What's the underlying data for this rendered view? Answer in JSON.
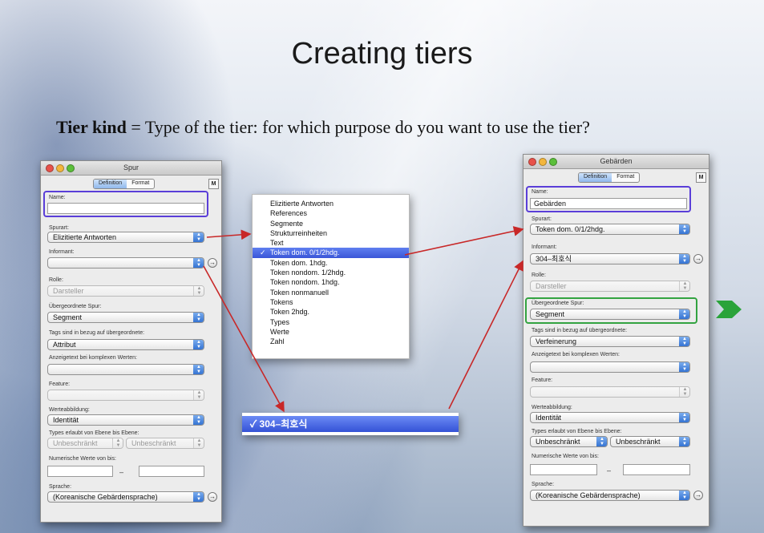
{
  "slide": {
    "title": "Creating tiers",
    "subtitle_bold": "Tier kind",
    "subtitle_rest": " = Type of the tier: for which purpose do you want to use the tier?"
  },
  "left_window": {
    "title": "Spur",
    "tab_definition": "Definition",
    "tab_format": "Format",
    "m_button": "M",
    "name_label": "Name:",
    "name_value": "",
    "spurart_label": "Spurart:",
    "spurart_value": "Elizitierte Antworten",
    "informant_label": "Informant:",
    "informant_value": "",
    "rolle_label": "Rolle:",
    "rolle_value": "Darsteller",
    "parent_label": "Übergeordnete Spur:",
    "parent_value": "Segment",
    "tags_label": "Tags sind in bezug auf übergeordnete:",
    "tags_value": "Attribut",
    "display_label": "Anzeigetext bei komplexen Werten:",
    "display_value": "",
    "feature_label": "Feature:",
    "feature_value": "",
    "mapping_label": "Werteabbildung:",
    "mapping_value": "Identität",
    "types_label": "Types erlaubt von Ebene bis Ebene:",
    "types_from": "Unbeschränkt",
    "types_to": "Unbeschränkt",
    "numeric_label": "Numerische Werte von bis:",
    "numeric_dash": "–",
    "language_label": "Sprache:",
    "language_value": "(Koreanische Gebärdensprache)"
  },
  "tier_menu": {
    "items": [
      "Elizitierte Antworten",
      "References",
      "Segmente",
      "Strukturreinheiten",
      "Text",
      "Token dom. 0/1/2hdg.",
      "Token dom. 1hdg.",
      "Token nondom. 1/2hdg.",
      "Token nondom. 1hdg.",
      "Token nonmanuell",
      "Tokens",
      "Token 2hdg.",
      "Types",
      "Werte",
      "Zahl"
    ],
    "selected": "Token dom. 0/1/2hdg.",
    "check": "✓"
  },
  "informant_menu": {
    "check": "✓",
    "selected": "304–최호식"
  },
  "right_window": {
    "title": "Gebärden",
    "tab_definition": "Definition",
    "tab_format": "Format",
    "m_button": "M",
    "name_label": "Name:",
    "name_value": "Gebärden",
    "spurart_label": "Spurart:",
    "spurart_value": "Token dom. 0/1/2hdg.",
    "informant_label": "Informant:",
    "informant_value": "304–최호식",
    "rolle_label": "Rolle:",
    "rolle_value": "Darsteller",
    "parent_label": "Übergeordnete Spur:",
    "parent_value": "Segment",
    "tags_label": "Tags sind in bezug auf übergeordnete:",
    "tags_value": "Verfeinerung",
    "display_label": "Anzeigetext bei komplexen Werten:",
    "display_value": "",
    "feature_label": "Feature:",
    "feature_value": "",
    "mapping_label": "Werteabbildung:",
    "mapping_value": "Identität",
    "types_label": "Types erlaubt von Ebene bis Ebene:",
    "types_from": "Unbeschränkt",
    "types_to": "Unbeschränkt",
    "numeric_label": "Numerische Werte von bis:",
    "numeric_dash": "–",
    "language_label": "Sprache:",
    "language_value": "(Koreanische Gebärdensprache)"
  },
  "colors": {
    "highlight_blue": "#5a3ed8",
    "highlight_green": "#33a341",
    "arrow_red": "#c82828",
    "menu_selection": "#3a56d8",
    "chevron_green": "#2aa33a"
  }
}
